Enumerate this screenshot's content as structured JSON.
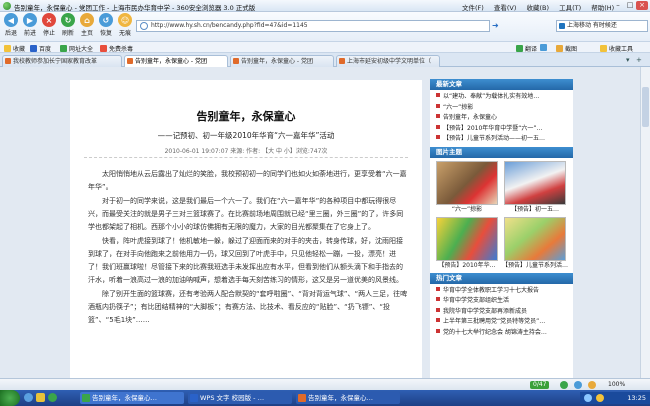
{
  "window": {
    "title": "告别童年，永保童心 - 党团工作 - 上海市民办华育中学 - 360安全浏览器 3.0 正式版"
  },
  "menu": [
    "文件(F)",
    "查看(V)",
    "收藏(B)",
    "工具(T)",
    "帮助(H)"
  ],
  "toolbar": {
    "back": "后退",
    "forward": "前进",
    "stop": "停止",
    "refresh": "刷新",
    "home": "主页",
    "restore": "恢复",
    "traceless": "无痕"
  },
  "address": {
    "url": "http://www.hy.sh.cn/bencandy.php?fid=47&id=1145"
  },
  "search": {
    "text": "上海移动 有时候还"
  },
  "favorites": {
    "collect_label": "收藏",
    "items": [
      "百度",
      "网址大全",
      "免费杀毒"
    ],
    "right_items": [
      "翻译",
      "",
      "截图"
    ],
    "favorites_folder": "收藏工具"
  },
  "tabs": [
    {
      "label": "我校教师参加长宁国家教育改革",
      "active": false
    },
    {
      "label": "告别童年，永保童心 - 党团",
      "active": true
    },
    {
      "label": "告别童年，永保童心 - 党团",
      "active": false
    },
    {
      "label": "上海市延安初级中学文明单位（",
      "active": false
    }
  ],
  "article": {
    "title": "告别童年，永保童心",
    "subtitle": "——记预初、初一年级2010年华育“六一嘉年华”活动",
    "meta": "2010-06-01 19:07:07 来源: 作者: 【大 中 小】浏览:747次",
    "paragraphs": [
      "太阳悄悄地从云后露出了灿烂的笑脸，我校预初初一的同学们也如火如荼地进行，更享受着“六一嘉年华”。",
      "对于初一的同学来说，这是我们最后一个六一了。我们在“六一嘉年华”的各种项目中都玩得很尽兴，而最受关注的就是男子三对三篮球赛了。在比赛前场地周围就已经“里三圈，外三圈”的了，许多同学也都架起了相机。西那个小小的球仿佛拥有无限的魔力，大家的目光都聚集在了它身上了。",
      "快看，阵叶虎接到球了！他机敏地一躲，躲过了迎面而来的对手的夹击，转身传球，好，沈雨阳接到球了，在对手向他跑来之前他用力一仍，球又回到了叶虎手中，只见他轻松一蹦，一投，漂亮！进了！我们班赢球啦！尽管接下来的比赛我班选手未发挥出应有水平，但看到他们从额头滴下和手指去的汗水，听着一浪高过一浪的加油呐喊声，想着选手每天刻苦练习的情形，这又是另一道优美的风景线。",
      "除了别开生面的篮球赛，还有考验两人配合默契的“套呼啦圈”、“背对背运气球”、“两人三足，往啤酒瓶内扔筷子”；有比团结精神的“大脚板”；有赛方法、比技术、看反应的“贴脸”、“扔飞镖”、“投篮”、“5毛1块”……"
    ]
  },
  "sidebar": {
    "latest": {
      "title": "最新文章",
      "items": [
        "以“建功、奉献”为载体扎实有效地…",
        "“六一”掠影",
        "告别童年，永保童心",
        "【预告】2010年华育中学暨“六一”…",
        "【预告】儿童节系列活动——初一五…"
      ]
    },
    "gallery": {
      "title": "图片主题",
      "items": [
        "“六一”掠影",
        "【预告】初一五…",
        "【预告】2010年华…",
        "【预告】儿童节系列活…"
      ]
    },
    "hot": {
      "title": "热门文章",
      "items": [
        "华育中学全体教职工学习十七大报告",
        "华育中学党支部组织生活",
        "我院华育中学党支部再添新成员",
        "上半年第三批聘用党“党员特等党员”…",
        "党的十七大举行纪念会 胡锦涛主持会…"
      ]
    }
  },
  "statusbar": {
    "badge": "0/47",
    "zoom": "100%"
  },
  "taskbar": {
    "tasks": [
      "告别童年，永保童心…",
      "WPS 文字 校园版 - …",
      "告别童年，永保童心…"
    ],
    "clock": "13:25"
  },
  "colors": {
    "accent": "#2468a8",
    "sidebar_bullet": "#cc3333"
  }
}
